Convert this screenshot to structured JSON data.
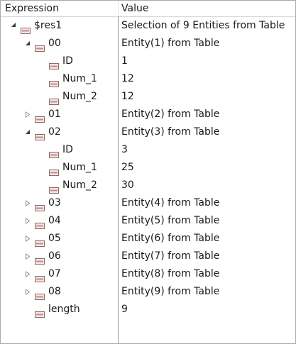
{
  "header": {
    "expression_label": "Expression",
    "value_label": "Value"
  },
  "rows": [
    {
      "name": "$res1",
      "value": "Selection of 9 Entities from Table",
      "level": 0,
      "state": "expanded"
    },
    {
      "name": "00",
      "value": "Entity(1) from Table",
      "level": 1,
      "state": "expanded"
    },
    {
      "name": "ID",
      "value": "1",
      "level": 2,
      "state": "leaf"
    },
    {
      "name": "Num_1",
      "value": "12",
      "level": 2,
      "state": "leaf"
    },
    {
      "name": "Num_2",
      "value": "12",
      "level": 2,
      "state": "leaf"
    },
    {
      "name": "01",
      "value": "Entity(2) from Table",
      "level": 1,
      "state": "collapsed"
    },
    {
      "name": "02",
      "value": "Entity(3) from Table",
      "level": 1,
      "state": "expanded"
    },
    {
      "name": "ID",
      "value": "3",
      "level": 2,
      "state": "leaf"
    },
    {
      "name": "Num_1",
      "value": "25",
      "level": 2,
      "state": "leaf"
    },
    {
      "name": "Num_2",
      "value": "30",
      "level": 2,
      "state": "leaf"
    },
    {
      "name": "03",
      "value": "Entity(4) from Table",
      "level": 1,
      "state": "collapsed"
    },
    {
      "name": "04",
      "value": "Entity(5) from Table",
      "level": 1,
      "state": "collapsed"
    },
    {
      "name": "05",
      "value": "Entity(6) from Table",
      "level": 1,
      "state": "collapsed"
    },
    {
      "name": "06",
      "value": "Entity(7) from Table",
      "level": 1,
      "state": "collapsed"
    },
    {
      "name": "07",
      "value": "Entity(8) from Table",
      "level": 1,
      "state": "collapsed"
    },
    {
      "name": "08",
      "value": "Entity(9) from Table",
      "level": 1,
      "state": "collapsed"
    },
    {
      "name": "length",
      "value": "9",
      "level": 1,
      "state": "leaf"
    }
  ],
  "icons": {
    "expanded": "expanded-triangle-icon",
    "collapsed": "collapsed-triangle-icon",
    "field": "field-icon"
  },
  "colors": {
    "icon_stroke": "#8a6a6a",
    "icon_fill": "#f2e6e6",
    "icon_band": "#c98a8a",
    "toggle_expanded": "#3a3a3a",
    "toggle_collapsed": "#8c8c8c"
  }
}
